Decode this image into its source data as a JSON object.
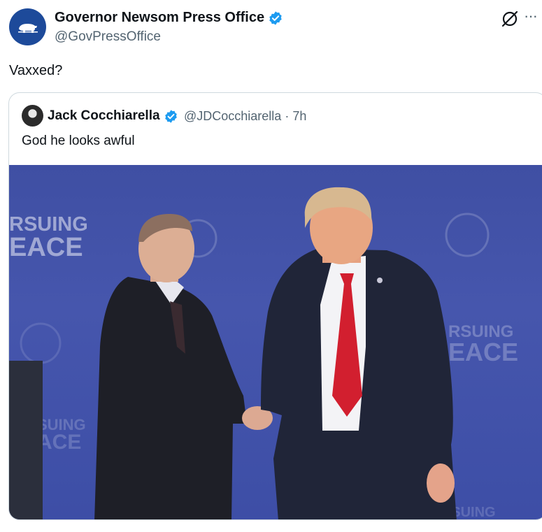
{
  "tweet": {
    "author_name": "Governor Newsom Press Office",
    "handle": "@GovPressOffice",
    "text": "Vaxxed?",
    "verified": true
  },
  "actions": {
    "grok_icon": "grok-icon",
    "more_label": "···"
  },
  "quoted_tweet": {
    "author_name": "Jack Cocchiarella",
    "handle": "@JDCocchiarella",
    "separator": "·",
    "time": "7h",
    "text": "God he looks awful",
    "verified": true,
    "image_backdrop": {
      "line1": "RSUING",
      "line2": "EACE",
      "line3": "RSUING",
      "line4": "EACE",
      "line5": "SUING",
      "line6": "ACE",
      "line7": "PURSUING"
    }
  },
  "colors": {
    "verified_blue": "#1d9bf0",
    "secondary_text": "#536471",
    "border": "#cfd9de",
    "backdrop_blue": "#4353aa"
  }
}
